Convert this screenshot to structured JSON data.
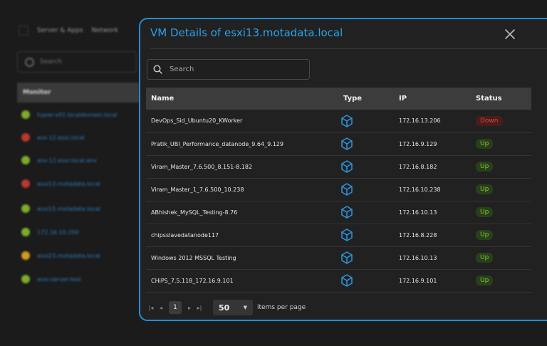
{
  "background": {
    "nav_items": [
      "Server & Apps",
      "Network"
    ],
    "search_placeholder": "Search",
    "monitor_header": "Monitor",
    "monitors": [
      {
        "label": "hyper-v01.localdomain.local",
        "status_color": "#7dab2a"
      },
      {
        "label": "esx-12.esxi.local",
        "status_color": "#b8392e"
      },
      {
        "label": "esx-12.esxi.local.env",
        "status_color": "#7dab2a"
      },
      {
        "label": "esxi13.motadata.local",
        "status_color": "#b8392e"
      },
      {
        "label": "esxi15.motadata.local",
        "status_color": "#7dab2a"
      },
      {
        "label": "172.16.10.250",
        "status_color": "#7dab2a"
      },
      {
        "label": "esxi23.motadata.local",
        "status_color": "#d49a1b"
      },
      {
        "label": "esxi-server-test",
        "status_color": "#7dab2a"
      }
    ]
  },
  "modal": {
    "title": "VM Details of esxi13.motadata.local",
    "close_icon": "close-icon",
    "search_placeholder": "Search",
    "columns": {
      "name": "Name",
      "type": "Type",
      "ip": "IP",
      "status": "Status"
    },
    "rows": [
      {
        "name": "DevOps_Sid_Ubuntu20_KWorker",
        "ip": "172.16.13.206",
        "status": "Down"
      },
      {
        "name": "Pratik_UBI_Performance_datanode_9.64_9.129",
        "ip": "172.16.9.129",
        "status": "Up"
      },
      {
        "name": "Viram_Master_7.6.500_8.151-8.182",
        "ip": "172.16.8.182",
        "status": "Up"
      },
      {
        "name": "Viram_Master_1_7.6.500_10.238",
        "ip": "172.16.10.238",
        "status": "Up"
      },
      {
        "name": "ABhishek_MySQL_Testing-8.76",
        "ip": "172.16.10.13",
        "status": "Up"
      },
      {
        "name": "chipsslavedatanode117",
        "ip": "172.16.8.228",
        "status": "Up"
      },
      {
        "name": "Windows 2012 MSSQL Testing",
        "ip": "172.16.10.13",
        "status": "Up"
      },
      {
        "name": "CHiPS_7.5.118_172.16.9.101",
        "ip": "172.16.9.101",
        "status": "Up"
      }
    ],
    "pagination": {
      "current_page": "1",
      "page_size": "50",
      "per_page_label": "items per page"
    },
    "colors": {
      "accent": "#1f8fd6",
      "up": "#8cc43c",
      "down": "#d0453c",
      "type_icon": "#2f95e0"
    }
  }
}
